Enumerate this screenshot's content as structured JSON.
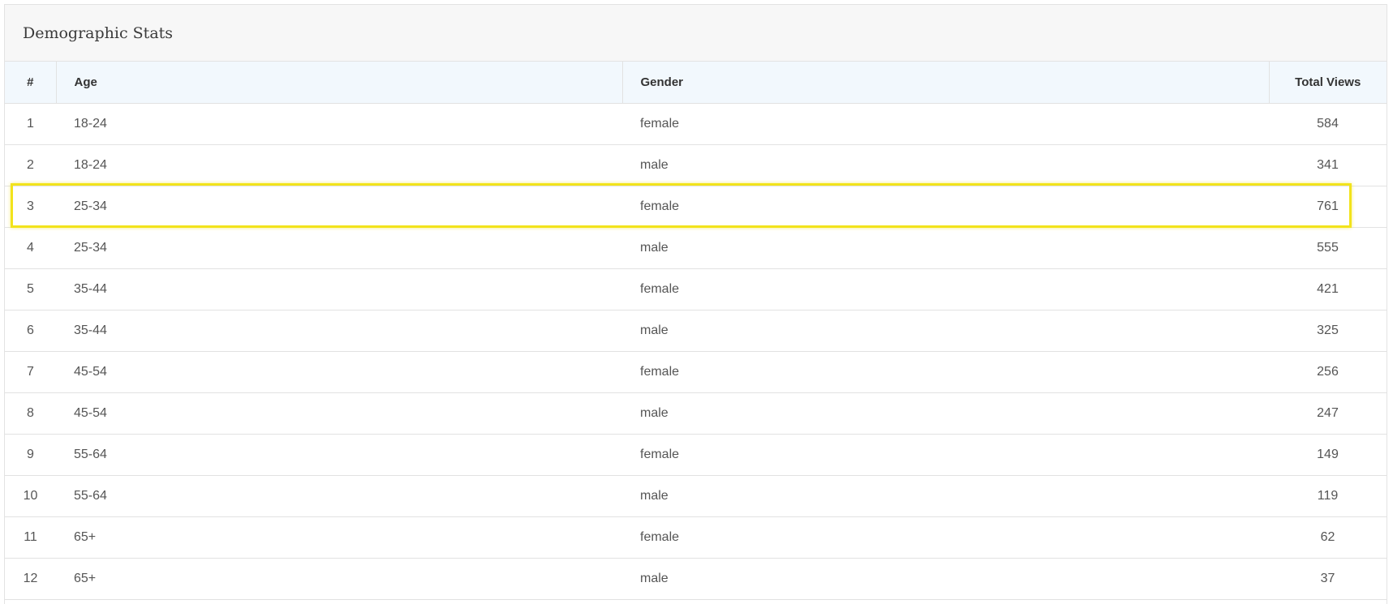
{
  "panel": {
    "title": "Demographic Stats"
  },
  "table": {
    "headers": {
      "num": "#",
      "age": "Age",
      "gender": "Gender",
      "views": "Total Views"
    },
    "rows": [
      {
        "num": "1",
        "age": "18-24",
        "gender": "female",
        "views": "584"
      },
      {
        "num": "2",
        "age": "18-24",
        "gender": "male",
        "views": "341"
      },
      {
        "num": "3",
        "age": "25-34",
        "gender": "female",
        "views": "761"
      },
      {
        "num": "4",
        "age": "25-34",
        "gender": "male",
        "views": "555"
      },
      {
        "num": "5",
        "age": "35-44",
        "gender": "female",
        "views": "421"
      },
      {
        "num": "6",
        "age": "35-44",
        "gender": "male",
        "views": "325"
      },
      {
        "num": "7",
        "age": "45-54",
        "gender": "female",
        "views": "256"
      },
      {
        "num": "8",
        "age": "45-54",
        "gender": "male",
        "views": "247"
      },
      {
        "num": "9",
        "age": "55-64",
        "gender": "female",
        "views": "149"
      },
      {
        "num": "10",
        "age": "55-64",
        "gender": "male",
        "views": "119"
      },
      {
        "num": "11",
        "age": "65+",
        "gender": "female",
        "views": "62"
      },
      {
        "num": "12",
        "age": "65+",
        "gender": "male",
        "views": "37"
      }
    ]
  },
  "highlight": {
    "row_number": "3",
    "color": "#f2e31b"
  },
  "colors": {
    "header_bg": "#f2f8fd",
    "panel_header_bg": "#f7f7f7",
    "border": "#e2e2e2"
  }
}
